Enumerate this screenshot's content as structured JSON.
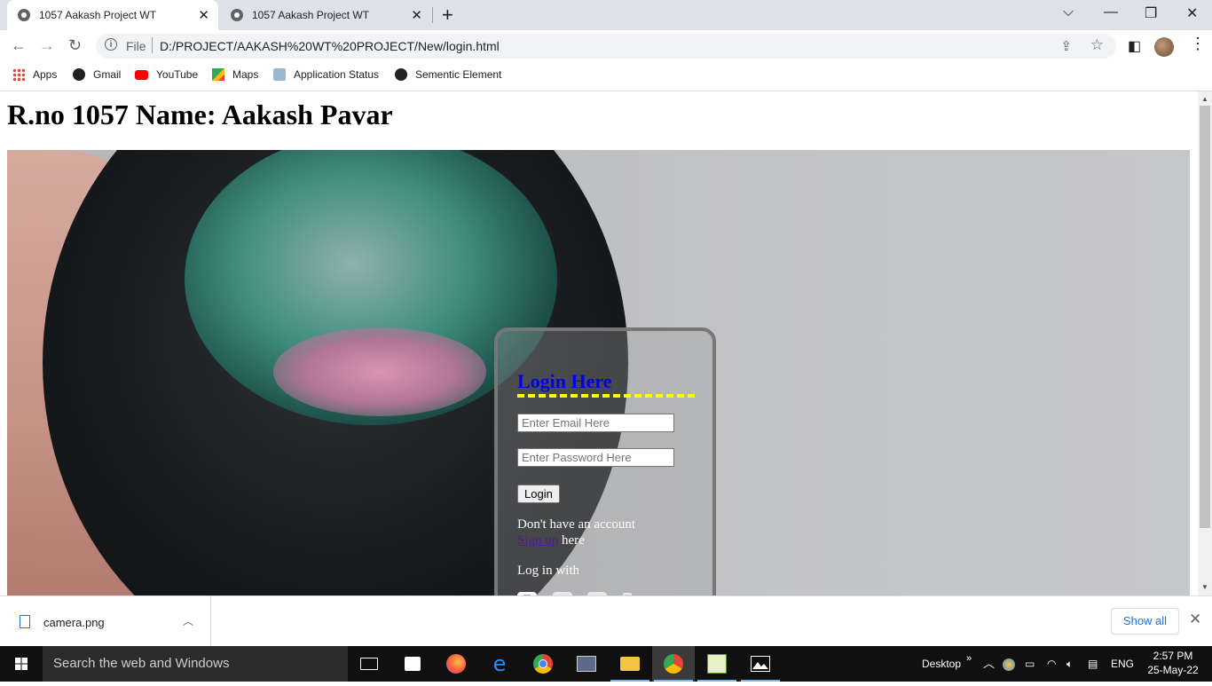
{
  "browser": {
    "tabs": [
      {
        "title": "1057 Aakash Project WT",
        "active": true
      },
      {
        "title": "1057 Aakash Project WT",
        "active": false
      }
    ],
    "new_tab_glyph": "+",
    "omnibox": {
      "scheme_label": "File",
      "url": "D:/PROJECT/AAKASH%20WT%20PROJECT/New/login.html"
    },
    "bookmarks": [
      {
        "label": "Apps",
        "icon": "apps-grid-icon"
      },
      {
        "label": "Gmail",
        "icon": "globe-icon"
      },
      {
        "label": "YouTube",
        "icon": "youtube-icon"
      },
      {
        "label": "Maps",
        "icon": "maps-icon"
      },
      {
        "label": "Application Status",
        "icon": "application-status-icon"
      },
      {
        "label": "Sementic Element",
        "icon": "globe-icon"
      }
    ]
  },
  "page": {
    "heading": "R.no 1057 Name: Aakash Pavar",
    "login": {
      "title": "Login Here",
      "email_placeholder": "Enter Email Here",
      "password_placeholder": "Enter Password Here",
      "login_button": "Login",
      "no_account_text": "Don't have an account",
      "signup_link": "Sign up",
      "signup_suffix": " here",
      "login_with": "Log in with",
      "social": [
        "instagram-icon",
        "twitter-icon",
        "linkedin-icon",
        "phone-icon"
      ]
    }
  },
  "downloads": {
    "file_name": "camera.png",
    "show_all": "Show all"
  },
  "taskbar": {
    "search_placeholder": "Search the web and Windows",
    "desktop_label": "Desktop",
    "language": "ENG",
    "time": "2:57 PM",
    "date": "25-May-22"
  },
  "colors": {
    "login_title": "#0000ee",
    "login_underline": "#ffff00",
    "link_visited": "#551a8b"
  }
}
